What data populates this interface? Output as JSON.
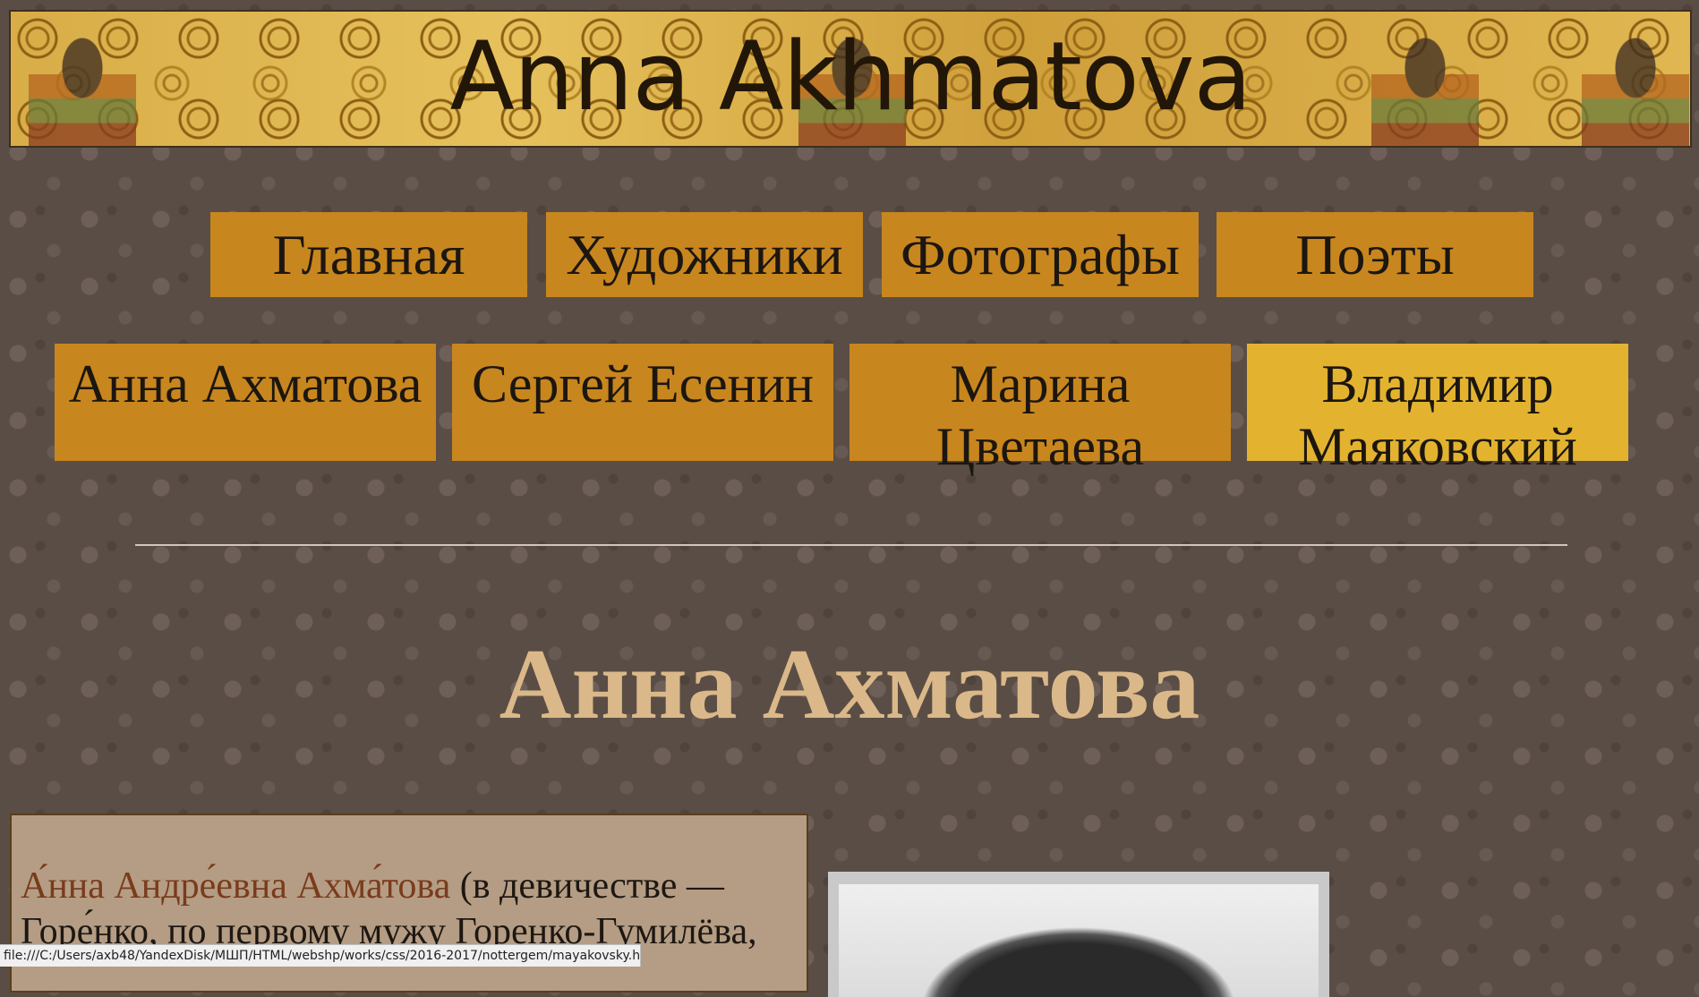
{
  "banner": {
    "title": "Anna Akhmatova"
  },
  "nav_main": [
    {
      "label": "Главная"
    },
    {
      "label": "Художники"
    },
    {
      "label": "Фотографы"
    },
    {
      "label": "Поэты"
    }
  ],
  "nav_poets": [
    {
      "label": "Анна Ахматова",
      "active": false
    },
    {
      "label": "Сергей Есенин",
      "active": false
    },
    {
      "label": "Марина Цветаева",
      "active": false
    },
    {
      "label": "Владимир Маяковский",
      "active": true
    }
  ],
  "page": {
    "heading": "Анна Ахматова"
  },
  "bio": {
    "name": "А́нна Андре́евна Ахма́това",
    "text": " (в девичестве — Горе́нко, по первому мужу Горенко-Гумилёва,"
  },
  "status_bar": {
    "url": "file:///C:/Users/axb48/YandexDisk/МШП/HTML/webshp/works/css/2016-2017/nottergem/mayakovsky.html"
  },
  "colors": {
    "nav_button": "#c8861e",
    "nav_active": "#e3b32f",
    "heading": "#dab889",
    "link": "#7a3b1c"
  }
}
